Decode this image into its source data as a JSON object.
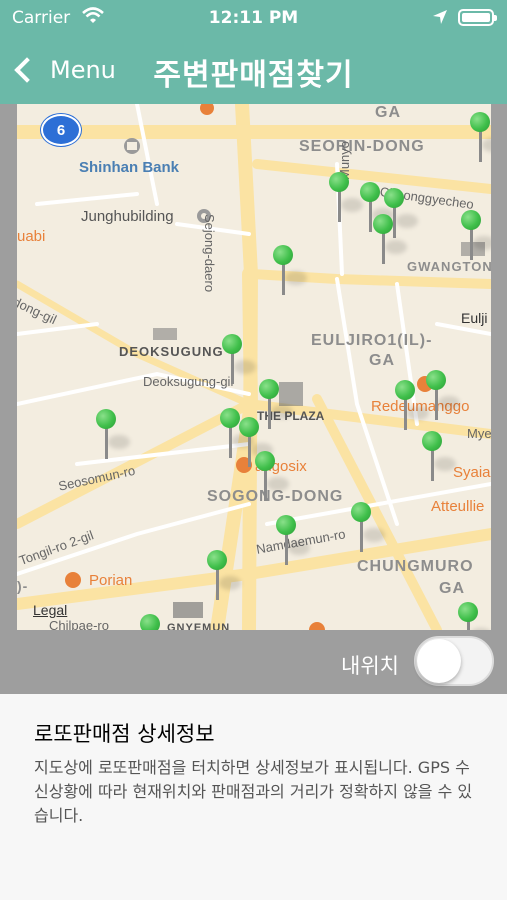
{
  "status_bar": {
    "carrier": "Carrier",
    "time": "12:11 PM"
  },
  "nav": {
    "back_label": "Menu",
    "title": "주변판매점찾기"
  },
  "map": {
    "highway_badge": "6",
    "labels": {
      "seorin_dong": "SEORIN-DONG",
      "ga_top": "GA",
      "shinhan_bank": "Shinhan Bank",
      "junghubilding": "Junghubilding",
      "uabi": "uabi",
      "sejong_daero": "Sejong-daero",
      "munyo": "Munyo",
      "cheonggyecheon": "Cheonggyecheo",
      "gwangtong": "GWANGTONG",
      "dong_gil": "dong-gil",
      "deoksugung": "DEOKSUGUNG",
      "euljiro1": "EULJIRO1(IL)-",
      "ga_mid": "GA",
      "eulji": "Eulji",
      "deoksugung_gil": "Deoksugung-gil",
      "the_plaza": "THE PLAZA",
      "redeumanggo": "Redeumanggo",
      "mye": "Mye",
      "seosomun_ro": "Seosomun-ro",
      "angosix": "angosix",
      "syaia": "Syaia",
      "sogong_dong": "SOGONG-DONG",
      "atteullie": "Atteullie",
      "tongil_ro": "Tongil-ro 2-gil",
      "namdaemun_ro": "Namdaemun-ro",
      "chungmuro": "CHUNGMURO",
      "ga_bottom": "GA",
      "porian": "Porian",
      "legal": "Legal",
      "chilpae_ro": "Chilpae-ro",
      "gnyemun": "GNYEMUN",
      "paren": ")-"
    }
  },
  "toggle": {
    "label": "내위치",
    "on": false
  },
  "info": {
    "title": "로또판매점 상세정보",
    "description": "지도상에 로또판매점을 터치하면 상세정보가 표시됩니다. GPS 수신상황에 따라 현재위치와 판매점과의 거리가 정확하지 않을 수 있습니다."
  },
  "colors": {
    "header": "#6bb9a8",
    "pin": "#3fbf4a",
    "band": "#9e9e9e"
  },
  "icons": [
    "wifi-icon",
    "location-arrow-icon",
    "battery-icon",
    "chevron-left-icon",
    "map-pin-icon",
    "highway-shield-icon"
  ]
}
